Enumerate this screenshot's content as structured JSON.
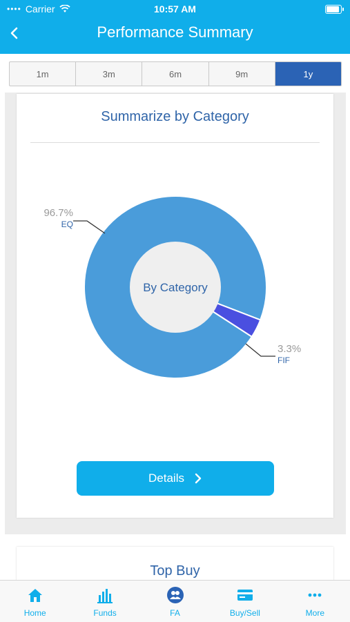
{
  "status_bar": {
    "carrier": "Carrier",
    "time": "10:57 AM"
  },
  "header": {
    "title": "Performance Summary"
  },
  "periods": {
    "options": [
      "1m",
      "3m",
      "6m",
      "9m",
      "1y"
    ],
    "selected": "1y"
  },
  "summary_card": {
    "title": "Summarize by Category",
    "center_label": "By Category",
    "details_label": "Details"
  },
  "chart_data": {
    "type": "pie",
    "style": "donut",
    "slices": [
      {
        "label": "EQ",
        "value": 96.7,
        "display": "96.7%",
        "color": "#4a9cda"
      },
      {
        "label": "FIF",
        "value": 3.3,
        "display": "3.3%",
        "color": "#4a4fe0"
      }
    ]
  },
  "top_buy": {
    "title": "Top Buy"
  },
  "tabbar": {
    "items": [
      {
        "label": "Home",
        "icon": "home-icon"
      },
      {
        "label": "Funds",
        "icon": "bar-chart-icon"
      },
      {
        "label": "FA",
        "icon": "advisor-icon"
      },
      {
        "label": "Buy/Sell",
        "icon": "card-icon"
      },
      {
        "label": "More",
        "icon": "more-dots-icon"
      }
    ]
  },
  "colors": {
    "header": "#10aeea",
    "accent": "#2b63b5",
    "title_text": "#2f64a8"
  }
}
